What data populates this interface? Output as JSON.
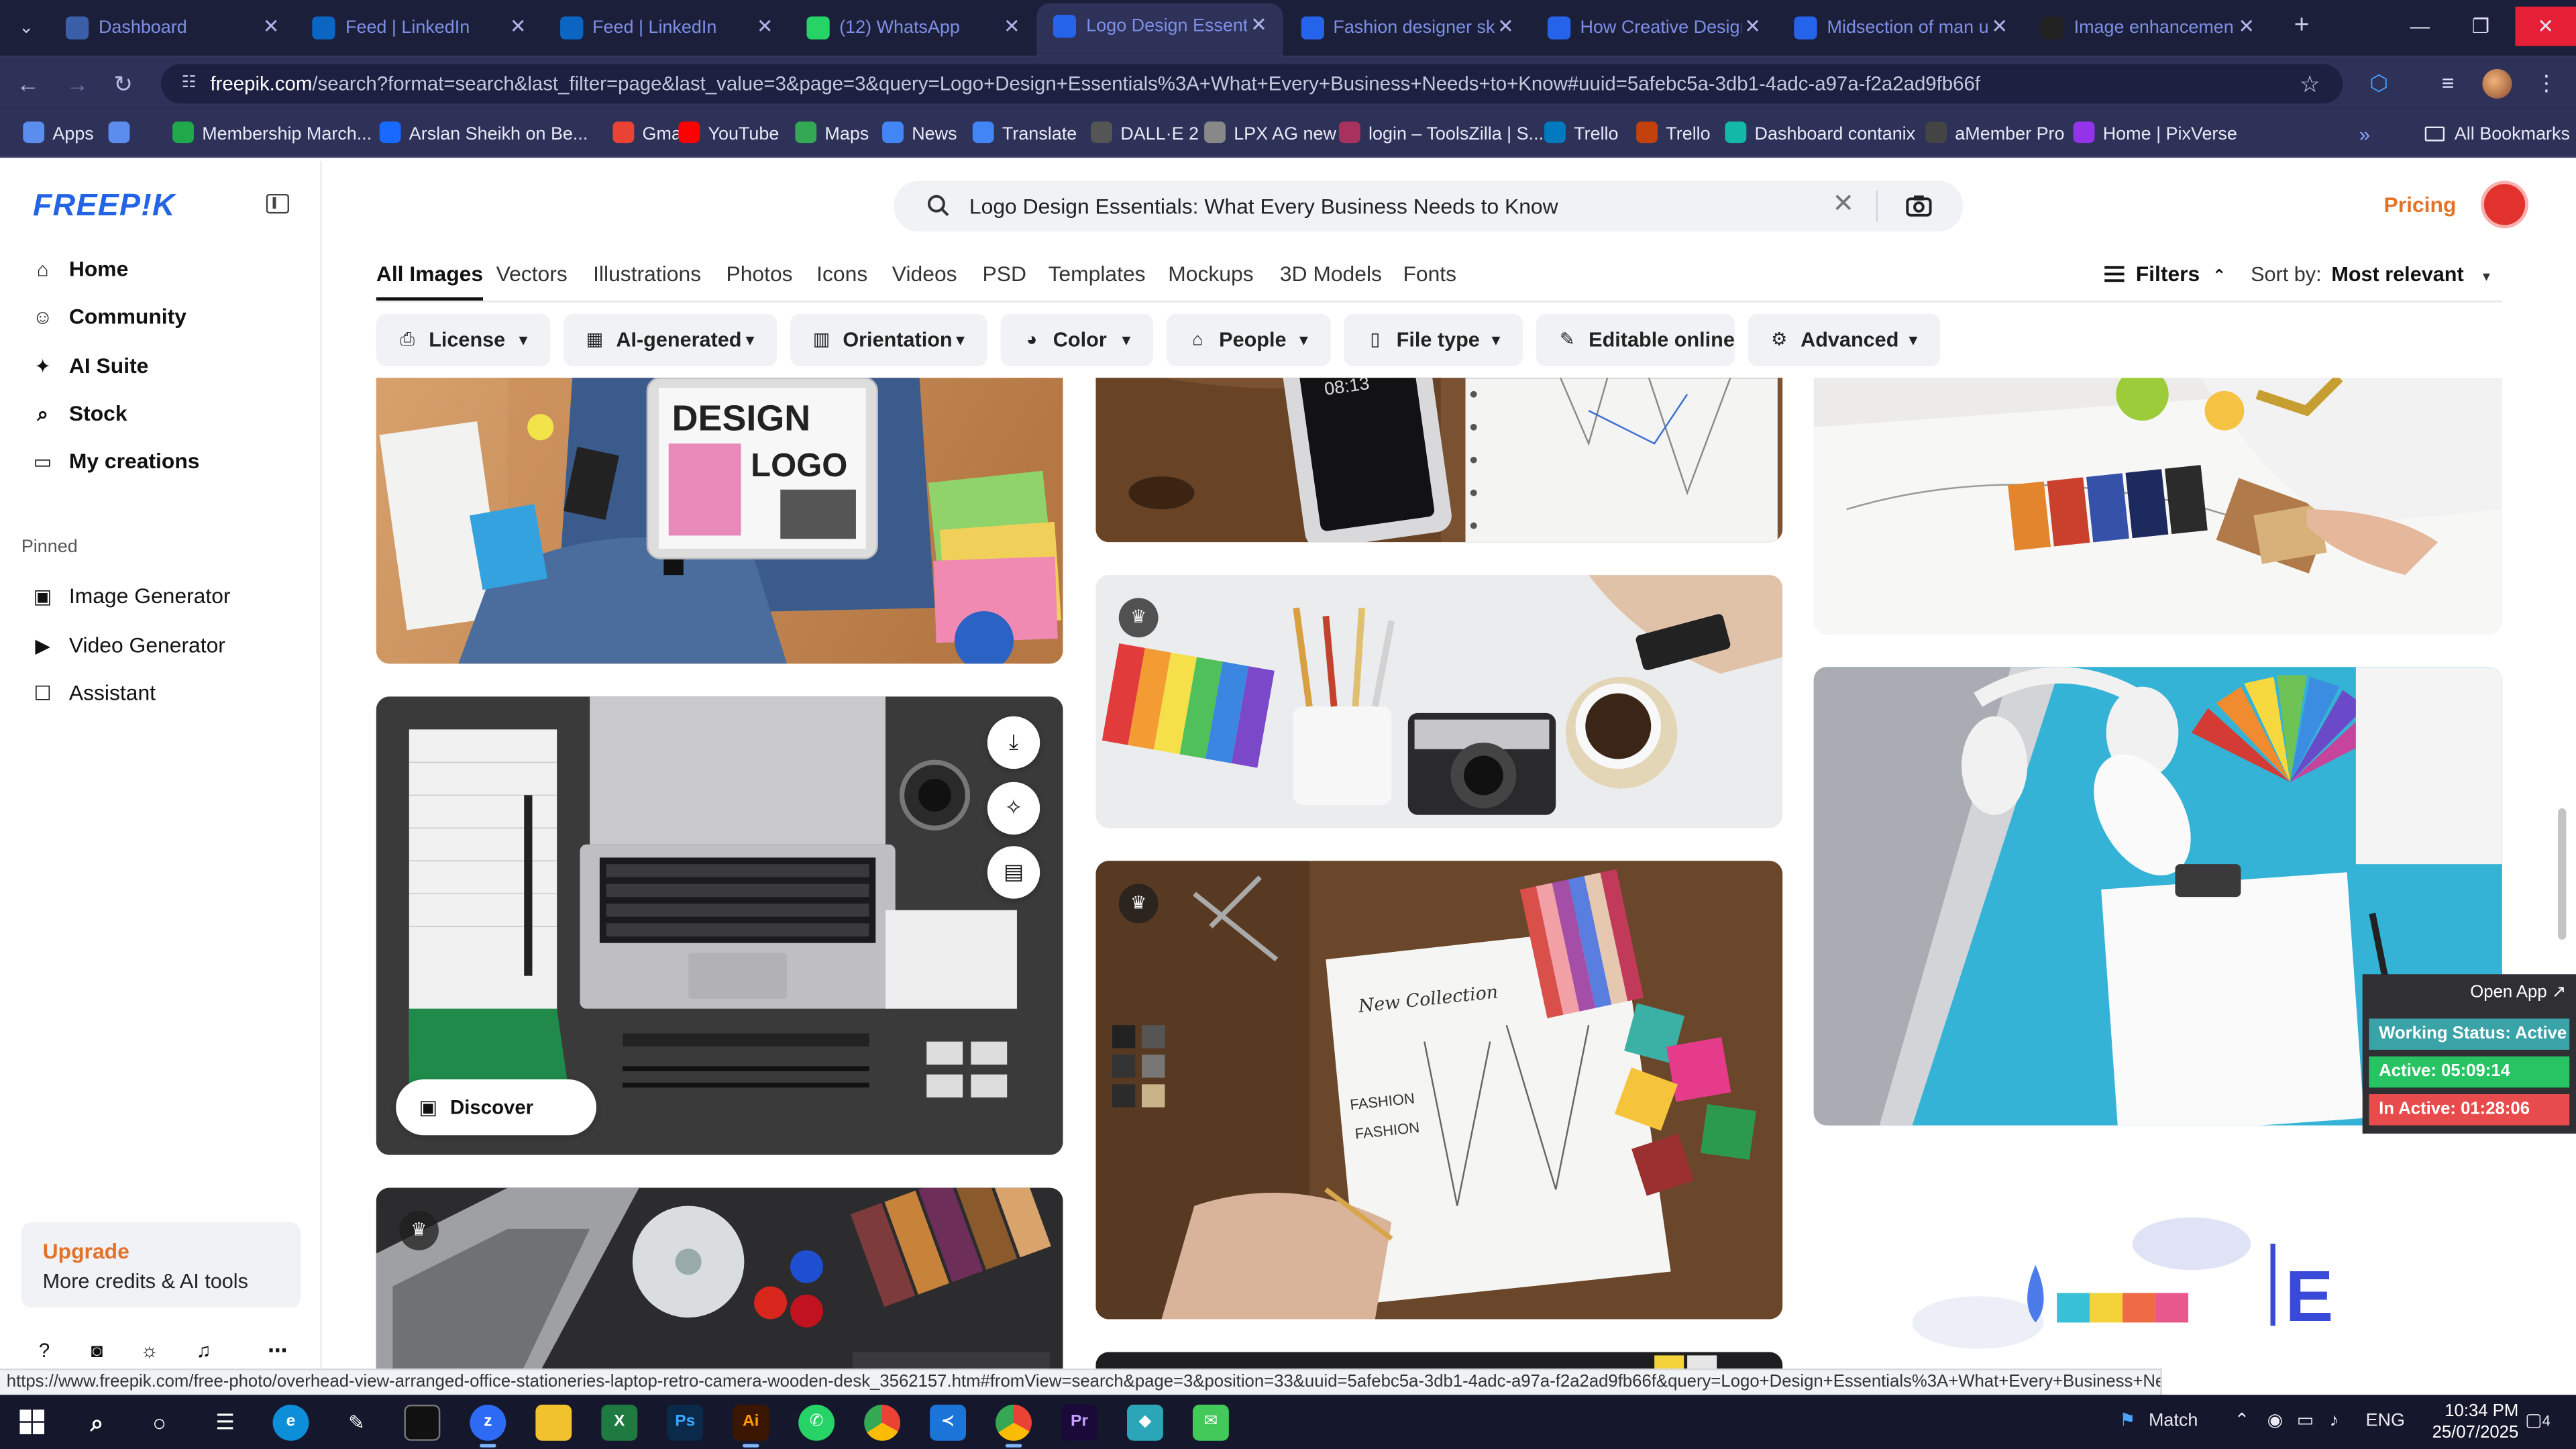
{
  "browser": {
    "tabs": [
      {
        "title": "Dashboard",
        "color": "#3b5ea8",
        "active": false
      },
      {
        "title": "Feed | LinkedIn",
        "color": "#0a66c2",
        "active": false
      },
      {
        "title": "Feed | LinkedIn",
        "color": "#0a66c2",
        "active": false
      },
      {
        "title": "(12) WhatsApp",
        "color": "#25d366",
        "active": false
      },
      {
        "title": "Logo Design Essenti",
        "color": "#2563eb",
        "active": true
      },
      {
        "title": "Fashion designer ske",
        "color": "#2563eb",
        "active": false
      },
      {
        "title": "How Creative Design",
        "color": "#2563eb",
        "active": false
      },
      {
        "title": "Midsection of man us",
        "color": "#2563eb",
        "active": false
      },
      {
        "title": "Image enhancement",
        "color": "#222222",
        "active": false
      }
    ],
    "url_host": "freepik.com",
    "url_rest": "/search?format=search&last_filter=page&last_value=3&page=3&query=Logo+Design+Essentials%3A+What+Every+Business+Needs+to+Know#uuid=5afebc5a-3db1-4adc-a97a-f2a2ad9fb66f",
    "bookmarks": [
      {
        "label": "Apps",
        "color": "#5b8def"
      },
      {
        "label": "",
        "color": "#5b8def"
      },
      {
        "label": "Membership March...",
        "color": "#20a84a"
      },
      {
        "label": "Arslan Sheikh on Be...",
        "color": "#1769ff"
      },
      {
        "label": "Gmail",
        "color": "#ea4335"
      },
      {
        "label": "YouTube",
        "color": "#ff0000"
      },
      {
        "label": "Maps",
        "color": "#34a853"
      },
      {
        "label": "News",
        "color": "#4285f4"
      },
      {
        "label": "Translate",
        "color": "#4285f4"
      },
      {
        "label": "DALL·E 2",
        "color": "#555555"
      },
      {
        "label": "LPX AG new",
        "color": "#888888"
      },
      {
        "label": "login – ToolsZilla | S...",
        "color": "#a8325e"
      },
      {
        "label": "Trello",
        "color": "#0079bf"
      },
      {
        "label": "Trello",
        "color": "#c2410c"
      },
      {
        "label": "Dashboard contanix",
        "color": "#14b8a6"
      },
      {
        "label": "aMember Pro",
        "color": "#444444"
      },
      {
        "label": "Home | PixVerse",
        "color": "#9333ea"
      }
    ],
    "all_bookmarks": "All Bookmarks",
    "status_url": "https://www.freepik.com/free-photo/overhead-view-arranged-office-stationeries-laptop-retro-camera-wooden-desk_3562157.htm#fromView=search&page=3&position=33&uuid=5afebc5a-3db1-4adc-a97a-f2a2ad9fb66f&query=Logo+Design+Essentials%3A+What+Every+Business+Needs+to+Know"
  },
  "sidebar": {
    "logo": "FREEP!K",
    "items": [
      {
        "label": "Home",
        "icon": "home-icon"
      },
      {
        "label": "Community",
        "icon": "community-icon"
      },
      {
        "label": "AI Suite",
        "icon": "sparkle-icon"
      },
      {
        "label": "Stock",
        "icon": "search-icon"
      },
      {
        "label": "My creations",
        "icon": "folder-icon"
      }
    ],
    "pinned_heading": "Pinned",
    "pinned": [
      {
        "label": "Image Generator",
        "icon": "image-icon"
      },
      {
        "label": "Video Generator",
        "icon": "video-icon"
      },
      {
        "label": "Assistant",
        "icon": "chat-icon"
      }
    ],
    "upgrade_title": "Upgrade",
    "upgrade_sub": "More credits & AI tools"
  },
  "header": {
    "search_query": "Logo Design Essentials: What Every Business Needs to Know",
    "pricing": "Pricing"
  },
  "type_tabs": [
    "All Images",
    "Vectors",
    "Illustrations",
    "Photos",
    "Icons",
    "Videos",
    "PSD",
    "Templates",
    "Mockups",
    "3D Models",
    "Fonts"
  ],
  "filters_label": "Filters",
  "sort_label": "Sort by:",
  "sort_value": "Most relevant",
  "chips": [
    {
      "label": "License",
      "icon": "license-icon",
      "w": 106
    },
    {
      "label": "AI-generated",
      "icon": "ai-icon",
      "w": 130
    },
    {
      "label": "Orientation",
      "icon": "orientation-icon",
      "w": 120
    },
    {
      "label": "Color",
      "icon": "palette-icon",
      "w": 93
    },
    {
      "label": "People",
      "icon": "people-icon",
      "w": 100
    },
    {
      "label": "File type",
      "icon": "file-icon",
      "w": 109
    },
    {
      "label": "Editable online",
      "icon": "brush-icon",
      "w": 121
    },
    {
      "label": "Advanced",
      "icon": "gear-icon",
      "w": 117
    }
  ],
  "grid": {
    "discover_label": "Discover similar",
    "tablet_text_1": "DESIGN",
    "tablet_text_2": "LOGO",
    "phone_time": "08:13",
    "sketch_title": "New Collection",
    "sketch_word_1": "FASHION",
    "sketch_word_2": "FASHION",
    "logo_letter": "E"
  },
  "tracker": {
    "open_label": "Open App ↗",
    "status": "Working Status: Active",
    "active": "Active: 05:09:14",
    "inactive": "In Active: 01:28:06",
    "colors": {
      "status": "#3aa3a8",
      "active": "#28c463",
      "inactive": "#e84b4b"
    }
  },
  "taskbar": {
    "match": "Match",
    "lang": "ENG",
    "time": "10:34 PM",
    "date": "25/07/2025",
    "notifications": "4"
  }
}
